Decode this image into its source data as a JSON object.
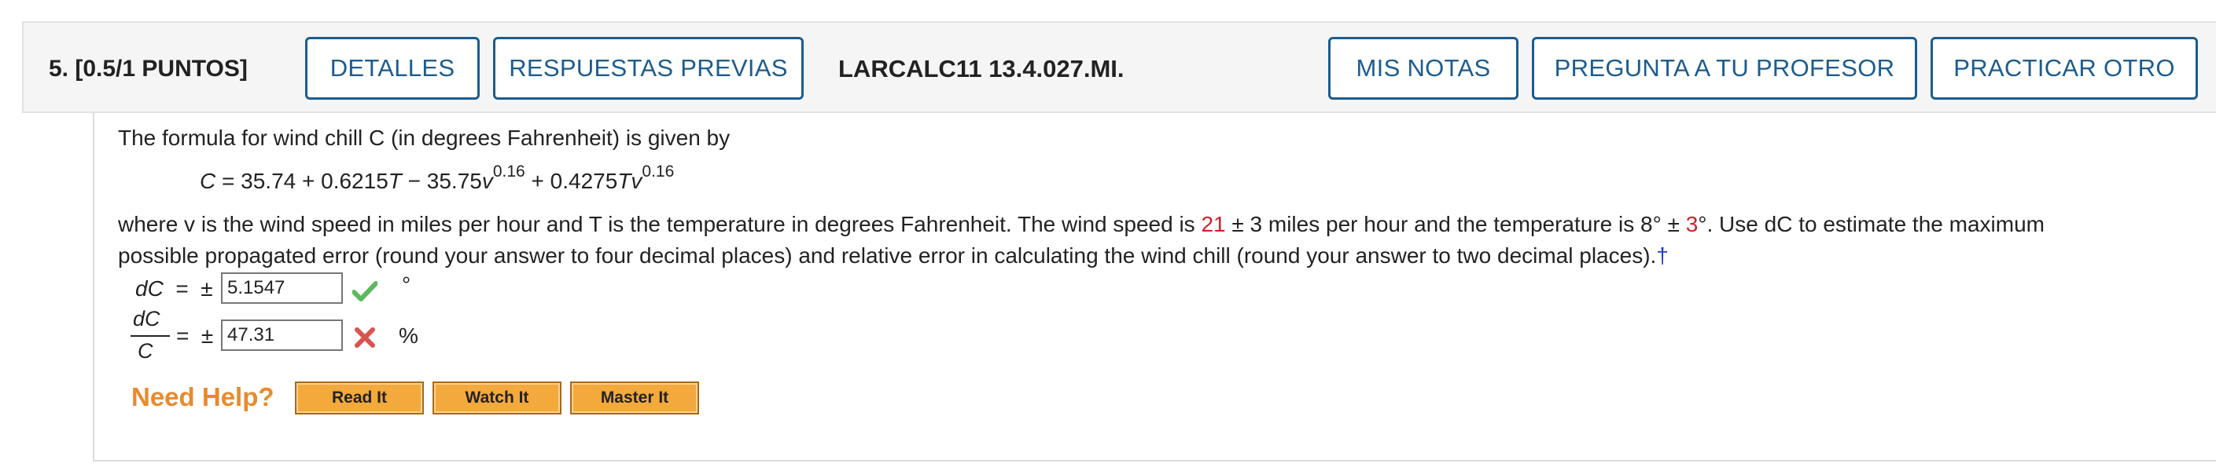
{
  "header": {
    "question_label": "5.  [0.5/1 PUNTOS]",
    "details_button": "DETALLES",
    "previous_answers_button": "RESPUESTAS PREVIAS",
    "assignment_id": "LARCALC11 13.4.027.MI.",
    "my_notes_button": "MIS NOTAS",
    "ask_teacher_button": "PREGUNTA A TU PROFESOR",
    "practice_another_button": "PRACTICAR OTRO"
  },
  "colors": {
    "button_border": "#1c5c8e",
    "highlight_red": "#d0212a",
    "need_help_orange": "#e98a2c",
    "help_button_fill": "#f4a93c",
    "check_green": "#5cb85c",
    "cross_red": "#d9534f"
  },
  "question": {
    "intro": "The formula for wind chill C (in degrees Fahrenheit) is given by",
    "formula": "C = 35.74 + 0.6215T − 35.75v^0.16 + 0.4275Tv^0.16",
    "body_line1_a": "where v is the wind speed in miles per hour and T is the temperature in degrees Fahrenheit. The wind speed is ",
    "wind_speed": "21",
    "body_line1_b": " ± 3 miles per hour and the temperature is 8° ± ",
    "temp_error": "3",
    "body_line1_c": "°. Use dC to estimate the maximum",
    "body_line2": "possible propagated error (round your answer to four decimal places) and relative error in calculating the wind chill (round your answer to two decimal places).",
    "dagger": "†"
  },
  "answers": {
    "dc_value": "5.1547",
    "dc_status": "correct",
    "dc_unit": "°",
    "rel_value": "47.31",
    "rel_status": "incorrect",
    "rel_unit": "%"
  },
  "help": {
    "label": "Need Help?",
    "read_it": "Read It",
    "watch_it": "Watch It",
    "master_it": "Master It"
  }
}
